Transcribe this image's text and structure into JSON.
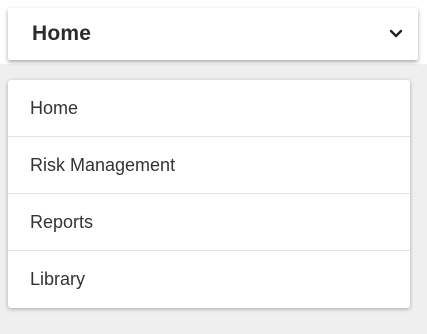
{
  "selector": {
    "value": "Home",
    "icon": "chevron-down-icon"
  },
  "menu": {
    "items": [
      {
        "label": "Home"
      },
      {
        "label": "Risk Management"
      },
      {
        "label": "Reports"
      },
      {
        "label": "Library"
      }
    ]
  }
}
